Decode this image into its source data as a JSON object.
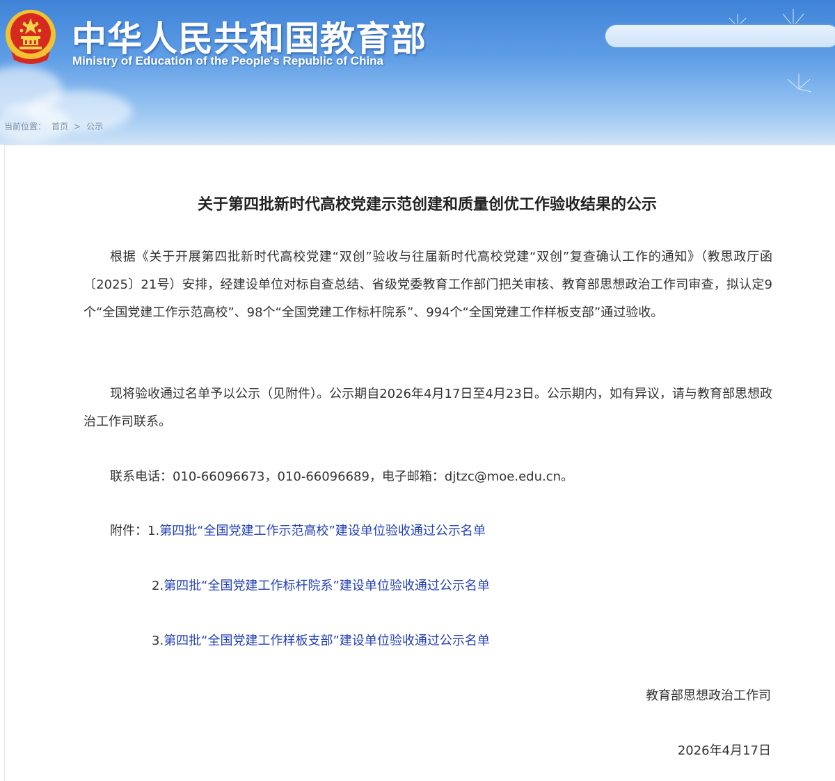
{
  "header": {
    "site_title": "中华人民共和国教育部",
    "site_subtitle": "Ministry of Education of the People's Republic of China",
    "search_placeholder": ""
  },
  "breadcrumb": {
    "prefix": "当前位置：",
    "home": "首页",
    "separator": ">",
    "current": "公示"
  },
  "article": {
    "title": "关于第四批新时代高校党建示范创建和质量创优工作验收结果的公示",
    "paragraph_1": "根据《关于开展第四批新时代高校党建“双创”验收与往届新时代高校党建“双创”复查确认工作的通知》（教思政厅函〔2025〕21号）安排，经建设单位对标自查总结、省级党委教育工作部门把关审核、教育部思想政治工作司审查，拟认定9个“全国党建工作示范高校”、98个“全国党建工作标杆院系”、994个“全国党建工作样板支部”通过验收。",
    "paragraph_2": "现将验收通过名单予以公示（见附件）。公示期自2026年4月17日至4月23日。公示期内，如有异议，请与教育部思想政治工作司联系。",
    "contact": "联系电话：010-66096673，010-66096689，电子邮箱：djtzc@moe.edu.cn。",
    "attachments_label": "附件：",
    "attachments": [
      {
        "number": "1.",
        "title": "第四批“全国党建工作示范高校”建设单位验收通过公示名单"
      },
      {
        "number": "2.",
        "title": "第四批“全国党建工作标杆院系”建设单位验收通过公示名单"
      },
      {
        "number": "3.",
        "title": "第四批“全国党建工作样板支部”建设单位验收通过公示名单"
      }
    ],
    "signature": "教育部思想政治工作司",
    "date": "2026年4月17日"
  },
  "colors": {
    "header_blue": "#3f83d8",
    "link_blue": "#2340b8",
    "text": "#333333"
  }
}
